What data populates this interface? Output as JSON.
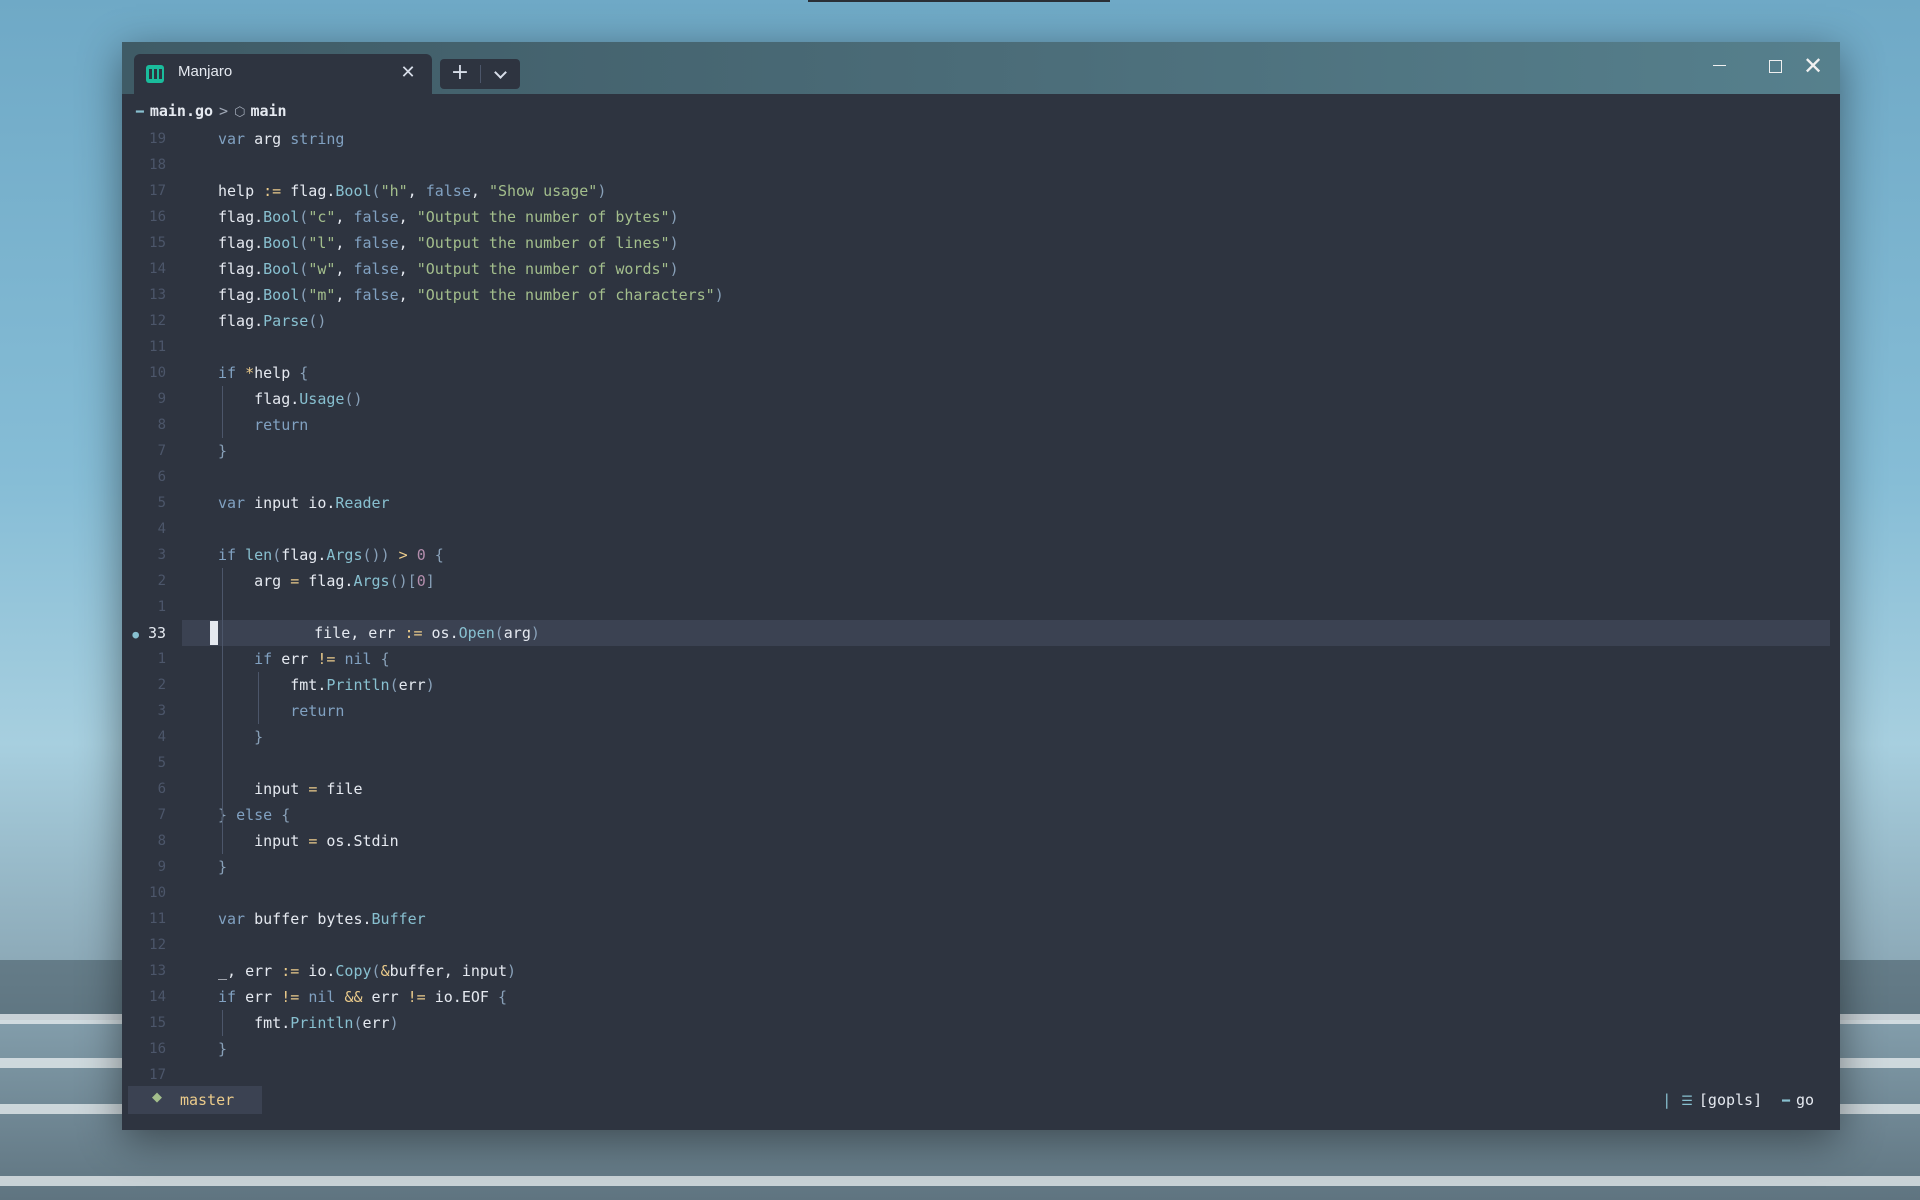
{
  "window": {
    "tab_title": "Manjaro",
    "tab_icon": "manjaro-logo-icon",
    "close_tab_glyph": "✕",
    "new_tab_glyph": "+",
    "close_glyph": "✕"
  },
  "breadcrumb": {
    "file": "main.go",
    "separator": ">",
    "symbol": "main"
  },
  "editor": {
    "current_line_number": "33",
    "lines": [
      {
        "n": "19",
        "code": "var arg string"
      },
      {
        "n": "18",
        "code": ""
      },
      {
        "n": "17",
        "code": "help := flag.Bool(\"h\", false, \"Show usage\")"
      },
      {
        "n": "16",
        "code": "flag.Bool(\"c\", false, \"Output the number of bytes\")"
      },
      {
        "n": "15",
        "code": "flag.Bool(\"l\", false, \"Output the number of lines\")"
      },
      {
        "n": "14",
        "code": "flag.Bool(\"w\", false, \"Output the number of words\")"
      },
      {
        "n": "13",
        "code": "flag.Bool(\"m\", false, \"Output the number of characters\")"
      },
      {
        "n": "12",
        "code": "flag.Parse()"
      },
      {
        "n": "11",
        "code": ""
      },
      {
        "n": "10",
        "code": "if *help {"
      },
      {
        "n": "9",
        "code": "    flag.Usage()"
      },
      {
        "n": "8",
        "code": "    return"
      },
      {
        "n": "7",
        "code": "}"
      },
      {
        "n": "6",
        "code": ""
      },
      {
        "n": "5",
        "code": "var input io.Reader"
      },
      {
        "n": "4",
        "code": ""
      },
      {
        "n": "3",
        "code": "if len(flag.Args()) > 0 {"
      },
      {
        "n": "2",
        "code": "    arg = flag.Args()[0]"
      },
      {
        "n": "1",
        "code": ""
      },
      {
        "n": "33",
        "code": "    file, err := os.Open(arg)"
      },
      {
        "n": "1",
        "code": "    if err != nil {"
      },
      {
        "n": "2",
        "code": "        fmt.Println(err)"
      },
      {
        "n": "3",
        "code": "        return"
      },
      {
        "n": "4",
        "code": "    }"
      },
      {
        "n": "5",
        "code": ""
      },
      {
        "n": "6",
        "code": "    input = file"
      },
      {
        "n": "7",
        "code": "} else {"
      },
      {
        "n": "8",
        "code": "    input = os.Stdin"
      },
      {
        "n": "9",
        "code": "}"
      },
      {
        "n": "10",
        "code": ""
      },
      {
        "n": "11",
        "code": "var buffer bytes.Buffer"
      },
      {
        "n": "12",
        "code": ""
      },
      {
        "n": "13",
        "code": "_, err := io.Copy(&buffer, input)"
      },
      {
        "n": "14",
        "code": "if err != nil && err != io.EOF {"
      },
      {
        "n": "15",
        "code": "    fmt.Println(err)"
      },
      {
        "n": "16",
        "code": "}"
      },
      {
        "n": "17",
        "code": ""
      }
    ]
  },
  "statusbar": {
    "branch": "master",
    "branch_icon": "git-branch-icon",
    "separator": "|",
    "lsp": "[gopls]",
    "filetype": "go"
  },
  "colors": {
    "background": "#2e3440",
    "keyword": "#81a1c1",
    "function": "#88c0d0",
    "string": "#a3be8c",
    "number": "#b48ead",
    "operator": "#ebcb8b",
    "line_number": "#4c566a",
    "branch": "#ebcb8b"
  }
}
